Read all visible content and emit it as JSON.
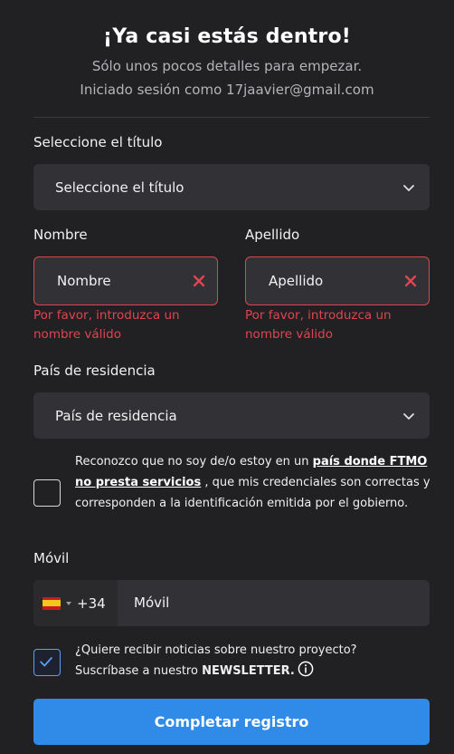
{
  "header": {
    "title": "¡Ya casi estás dentro!",
    "subtitle": "Sólo unos pocos detalles para empezar.",
    "signed_in": "Iniciado sesión como 17jaavier@gmail.com"
  },
  "form": {
    "title_field": {
      "label": "Seleccione el título",
      "value": "Seleccione el título"
    },
    "first_name": {
      "label": "Nombre",
      "placeholder": "Nombre",
      "error": "Por favor, introduzca un nombre válido"
    },
    "last_name": {
      "label": "Apellido",
      "placeholder": "Apellido",
      "error": "Por favor, introduzca un nombre válido"
    },
    "country": {
      "label": "País de residencia",
      "value": "País de residencia"
    },
    "consent": {
      "text_before": "Reconozco que no soy de/o estoy en un ",
      "link": "país donde FTMO no presta servicios",
      "text_after": " , que mis credenciales son correctas y corresponden a la identificación emitida por el gobierno.",
      "checked": false
    },
    "phone": {
      "label": "Móvil",
      "flag": "es-flag",
      "country_code": "+34",
      "placeholder": "Móvil"
    },
    "newsletter": {
      "line1": "¿Quiere recibir noticias sobre nuestro proyecto?",
      "line2_prefix": "Suscríbase a nuestro ",
      "line2_strong": "NEWSLETTER.",
      "checked": true
    },
    "submit_label": "Completar registro"
  },
  "colors": {
    "background": "#212124",
    "field": "#323236",
    "error": "#e04450",
    "accent": "#2f8ae8"
  }
}
